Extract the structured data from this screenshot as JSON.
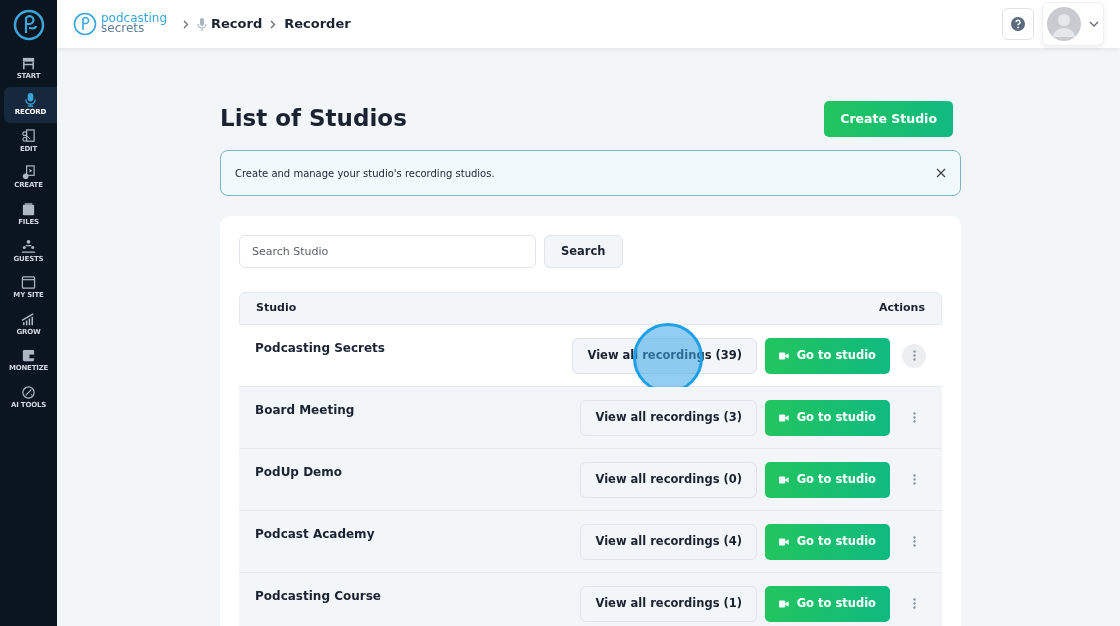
{
  "sidebar": {
    "items": [
      {
        "label": "START",
        "selected": false
      },
      {
        "label": "RECORD",
        "selected": true
      },
      {
        "label": "EDIT",
        "selected": false
      },
      {
        "label": "CREATE",
        "selected": false
      },
      {
        "label": "FILES",
        "selected": false
      },
      {
        "label": "GUESTS",
        "selected": false
      },
      {
        "label": "MY SITE",
        "selected": false
      },
      {
        "label": "GROW",
        "selected": false
      },
      {
        "label": "MONETIZE",
        "selected": false
      },
      {
        "label": "AI TOOLS",
        "selected": false
      }
    ]
  },
  "header": {
    "logo": {
      "line_1": "podcasting",
      "line_2": "secrets"
    },
    "breadcrumb": [
      "Record",
      "Recorder"
    ]
  },
  "page": {
    "title": "List of Studios",
    "create_button": "Create Studio",
    "alert": {
      "text": "Create and manage your studio's recording studios."
    },
    "search": {
      "placeholder": "Search Studio",
      "button": "Search"
    },
    "table": {
      "columns": [
        "Studio",
        "Actions"
      ],
      "rows": [
        {
          "name": "Podcasting Secrets",
          "recordings": "View all recordings (39)",
          "studio": "Go to studio",
          "hovered": true
        },
        {
          "name": "Board Meeting",
          "recordings": "View all recordings (3)",
          "studio": "Go to studio",
          "hovered": false
        },
        {
          "name": "PodUp Demo",
          "recordings": "View all recordings (0)",
          "studio": "Go to studio",
          "hovered": false
        },
        {
          "name": "Podcast Academy",
          "recordings": "View all recordings (4)",
          "studio": "Go to studio",
          "hovered": false
        },
        {
          "name": "Podcasting Course",
          "recordings": "View all recordings (1)",
          "studio": "Go to studio",
          "hovered": false
        }
      ]
    }
  }
}
